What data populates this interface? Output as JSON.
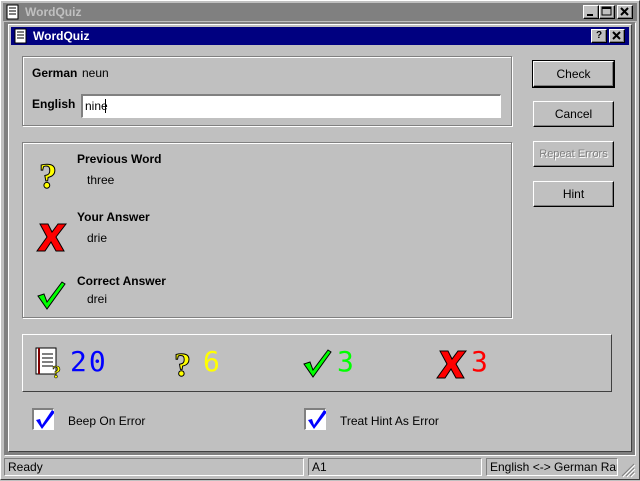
{
  "outer_window": {
    "title": "WordQuiz"
  },
  "dialog": {
    "title": "WordQuiz",
    "help_btn": "?",
    "close_btn": "×"
  },
  "quiz": {
    "german_label": "German",
    "german_word": "neun",
    "english_label": "English",
    "english_value": "nine"
  },
  "buttons": {
    "check": "Check",
    "cancel": "Cancel",
    "repeat_errors": "Repeat Errors",
    "hint": "Hint"
  },
  "results": {
    "previous_label": "Previous Word",
    "previous_value": "three",
    "answer_label": "Your Answer",
    "answer_value": "drie",
    "correct_label": "Correct Answer",
    "correct_value": "drei"
  },
  "stats": {
    "total": "20",
    "hints": "6",
    "correct": "3",
    "errors": "3",
    "colors": {
      "total": "#0000ff",
      "hints": "#ffff00",
      "correct": "#00ff00",
      "errors": "#ff0000"
    }
  },
  "options": {
    "beep_label": "Beep On Error",
    "beep_checked": true,
    "hint_error_label": "Treat Hint As Error",
    "hint_error_checked": true
  },
  "statusbar": {
    "ready": "Ready",
    "cell": "A1",
    "mode": "English <-> German Rando"
  }
}
